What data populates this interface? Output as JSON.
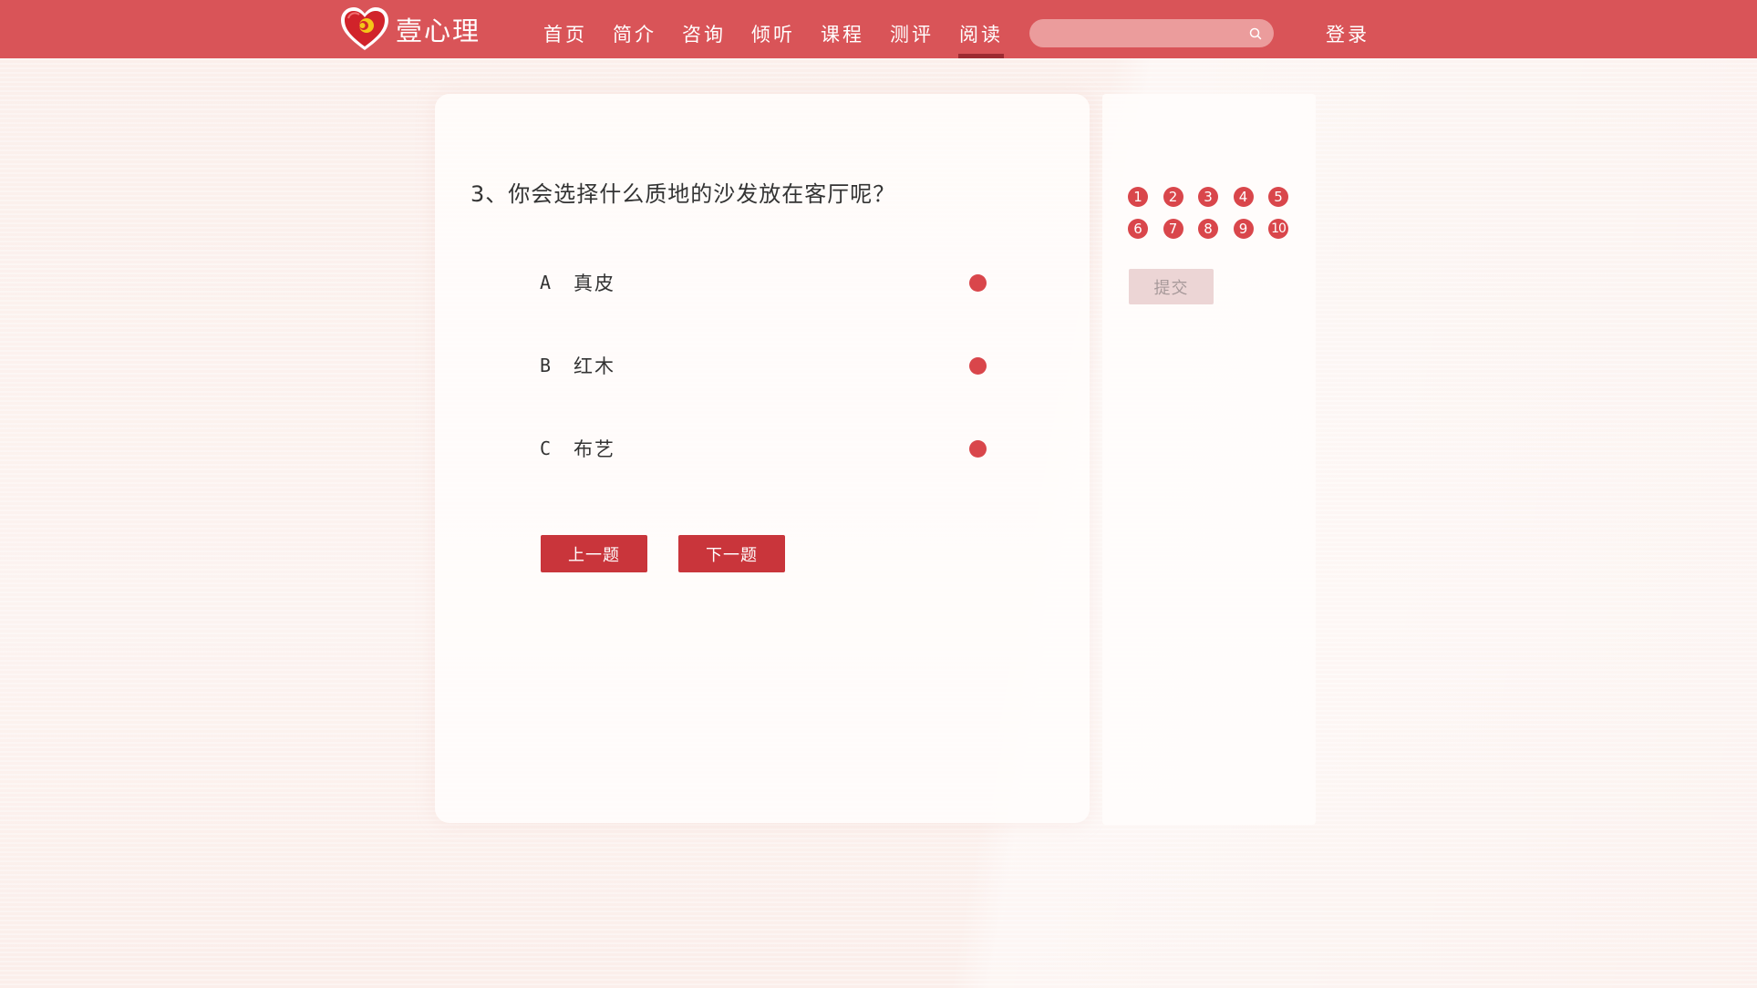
{
  "brand": {
    "name": "壹心理"
  },
  "nav": {
    "items": [
      {
        "label": "首页"
      },
      {
        "label": "简介"
      },
      {
        "label": "咨询"
      },
      {
        "label": "倾听"
      },
      {
        "label": "课程"
      },
      {
        "label": "测评"
      },
      {
        "label": "阅读"
      }
    ],
    "active": "阅读",
    "login": "登录"
  },
  "search": {
    "placeholder": "",
    "value": ""
  },
  "quiz": {
    "question": "3、你会选择什么质地的沙发放在客厅呢？",
    "options": [
      {
        "letter": "A",
        "text": "真皮"
      },
      {
        "letter": "B",
        "text": "红木"
      },
      {
        "letter": "C",
        "text": "布艺"
      }
    ],
    "prev_label": "上一题",
    "next_label": "下一题"
  },
  "sidebar": {
    "numbers": [
      "1",
      "2",
      "3",
      "4",
      "5",
      "6",
      "7",
      "8",
      "9",
      "10"
    ],
    "submit_label": "提交"
  },
  "colors": {
    "header": "#d95458",
    "accent": "#c9353b",
    "radio": "#d9464b",
    "submit_disabled": "#ecd5d5"
  }
}
